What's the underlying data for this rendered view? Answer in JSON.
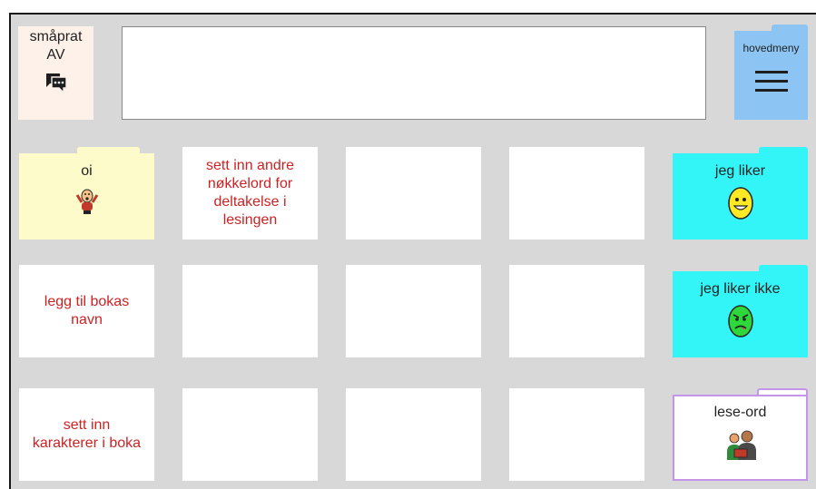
{
  "header": {
    "smallTalk": {
      "line1": "småprat",
      "line2": "AV",
      "icon": "chat-bubbles-icon"
    },
    "messageBar": {
      "value": ""
    },
    "mainMenu": {
      "label": "hovedmeny",
      "icon": "hamburger-menu-icon"
    }
  },
  "grid": {
    "r1": {
      "c1": "oi",
      "c2": "sett inn andre nøkkelord for deltakelse i lesingen",
      "c5": "jeg liker"
    },
    "r2": {
      "c1": "legg til bokas navn",
      "c5": "jeg liker ikke"
    },
    "r3": {
      "c1": "sett inn karakterer i boka",
      "c5": "lese-ord"
    }
  },
  "colors": {
    "folderYellow": "#fdfbc9",
    "folderCyan": "#33f4f7",
    "folderBlue": "#8cc5f3",
    "smallTalkBg": "#fdf1ea",
    "placeholderRed": "#cc2222",
    "leseBorder": "#c493ea"
  }
}
